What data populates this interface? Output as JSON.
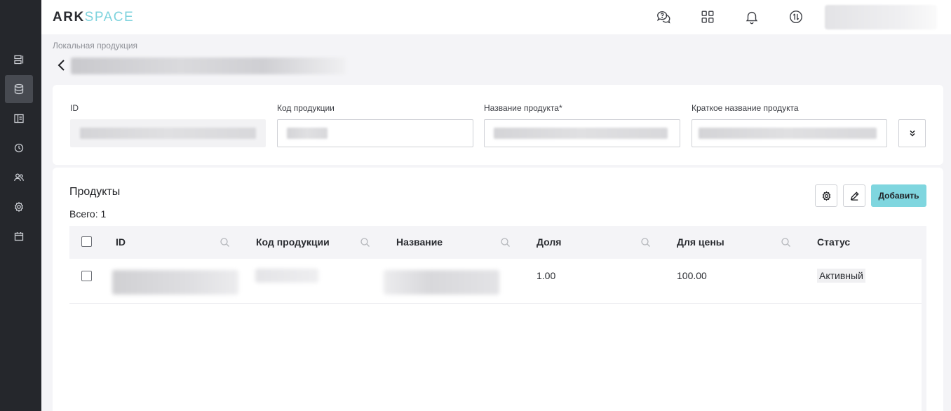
{
  "app": {
    "logo_part1": "ARK",
    "logo_part2": "SPACE"
  },
  "sidebar": {
    "items": [
      {
        "name": "dashboard-icon",
        "active": false
      },
      {
        "name": "database-icon",
        "active": true
      },
      {
        "name": "layout-icon",
        "active": false
      },
      {
        "name": "clock-icon",
        "active": false
      },
      {
        "name": "users-icon",
        "active": false
      },
      {
        "name": "gear-icon",
        "active": false
      },
      {
        "name": "calendar-icon",
        "active": false
      }
    ]
  },
  "topbar": {
    "icons": [
      "help-chat-icon",
      "apps-grid-icon",
      "bell-icon",
      "sync-icon"
    ]
  },
  "breadcrumb": "Локальная продукция",
  "filters": {
    "id_label": "ID",
    "code_label": "Код продукции",
    "name_label": "Название продукта*",
    "short_name_label": "Краткое название продукта"
  },
  "products": {
    "title": "Продукты",
    "total": "Всего: 1",
    "add_label": "Добавить",
    "columns": [
      "ID",
      "Код продукции",
      "Название",
      "Доля",
      "Для цены",
      "Статус"
    ],
    "rows": [
      {
        "share": "1.00",
        "price_for": "100.00",
        "status": "Активный"
      }
    ]
  },
  "colors": {
    "sidebar": "#25272c",
    "accent": "#7fd6df",
    "background": "#f4f4f7"
  }
}
